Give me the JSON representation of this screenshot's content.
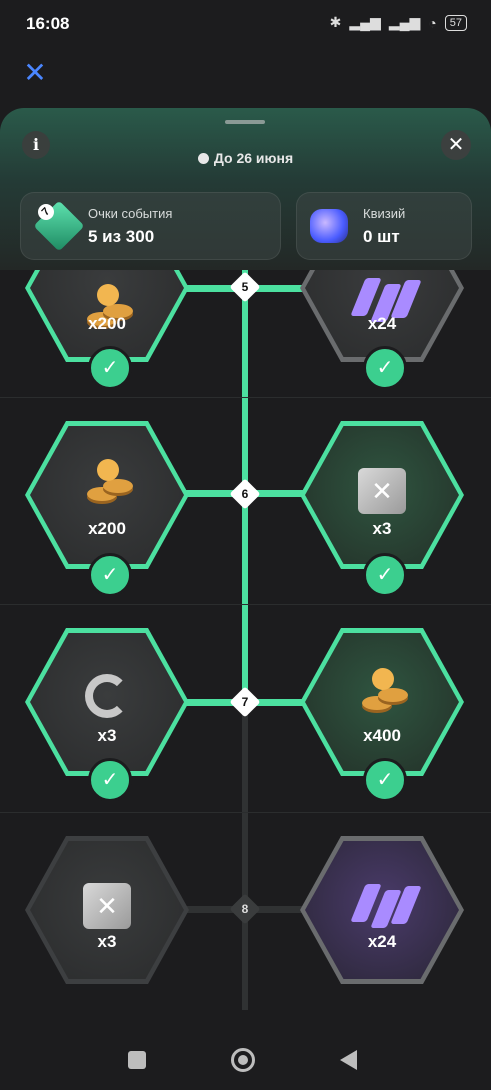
{
  "status_bar": {
    "time": "16:08",
    "battery": "57"
  },
  "panel": {
    "deadline": "До 26 июня",
    "info_label": "i"
  },
  "cards": [
    {
      "title": "Очки события",
      "value": "5 из 300",
      "badge": "7"
    },
    {
      "title": "Квизий",
      "value": "0 шт"
    }
  ],
  "levels": [
    {
      "level": "5",
      "left_qty": "x200",
      "right_qty": "x24"
    },
    {
      "level": "6",
      "left_qty": "x200",
      "right_qty": "x3"
    },
    {
      "level": "7",
      "left_qty": "x3",
      "right_qty": "x400"
    },
    {
      "level": "8",
      "left_qty": "x3",
      "right_qty": "x24"
    }
  ],
  "icons": {
    "close_top": "close-icon",
    "coins": "coins-icon",
    "lightning": "lightning-icon",
    "chip": "chip-icon",
    "refresh": "refresh-icon",
    "check": "check-icon"
  },
  "colors": {
    "accent_green": "#4ce0a0",
    "background": "#1c1c1e",
    "close_blue": "#4a86ff"
  }
}
